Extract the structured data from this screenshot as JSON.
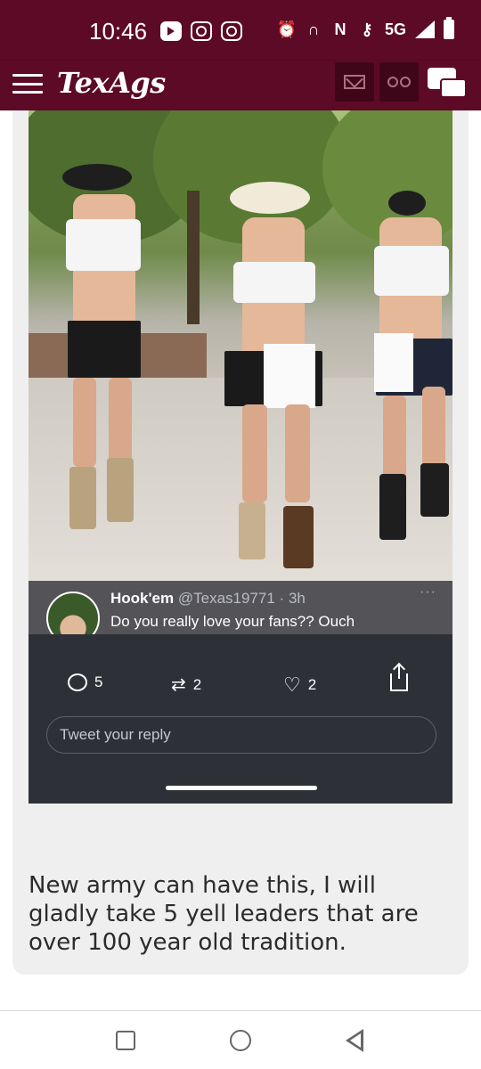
{
  "status_bar": {
    "time": "10:46",
    "network": "5G",
    "left_icons": [
      "youtube-icon",
      "camera-icon",
      "instagram-icon"
    ],
    "right_icons": [
      "alarm-icon",
      "headphones-icon",
      "nfc-icon",
      "key-icon",
      "signal-icon",
      "battery-icon"
    ]
  },
  "app_bar": {
    "logo": "TexAgs",
    "buttons": [
      "menu-icon",
      "mail-icon",
      "glasses-icon",
      "chat-icon"
    ],
    "brand_color": "#5c0a26"
  },
  "embedded_tweet": {
    "author_name": "Hook'em",
    "author_handle": "@Texas19771",
    "time_ago": "3h",
    "separator": "·",
    "more": "···",
    "text": "Do you really love your fans?? Ouch",
    "reply_count": "5",
    "retweet_count": "2",
    "like_count": "2",
    "reply_placeholder": "Tweet your reply"
  },
  "post": {
    "body": "New army can have this, I will gladly take 5 yell leaders that are over 100 year old tradition."
  },
  "nav": {
    "buttons": [
      "recent-apps-button",
      "home-button",
      "back-button"
    ]
  }
}
